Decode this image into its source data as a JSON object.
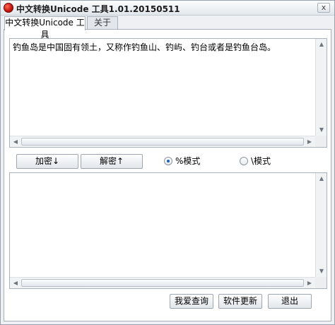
{
  "window": {
    "title": "中文转换Unicode 工具1.01.20150511",
    "close_label": "x"
  },
  "tabs": [
    {
      "label": "中文转换Unicode 工具",
      "active": true
    },
    {
      "label": "关于",
      "active": false
    }
  ],
  "input": {
    "value": "钓鱼岛是中国固有领土，又称作钓鱼山、钓屿、钓台或者是钓鱼台岛。"
  },
  "output": {
    "value": ""
  },
  "actions": {
    "encode_label": "加密↓",
    "decode_label": "解密↑"
  },
  "modes": [
    {
      "label": "%模式",
      "selected": true
    },
    {
      "label": "\\模式",
      "selected": false
    }
  ],
  "footer": {
    "query_label": "我爱查询",
    "update_label": "软件更新",
    "exit_label": "退出"
  },
  "scroll_arrows": {
    "up": "▲",
    "down": "▼",
    "left": "◀",
    "right": "▶"
  }
}
